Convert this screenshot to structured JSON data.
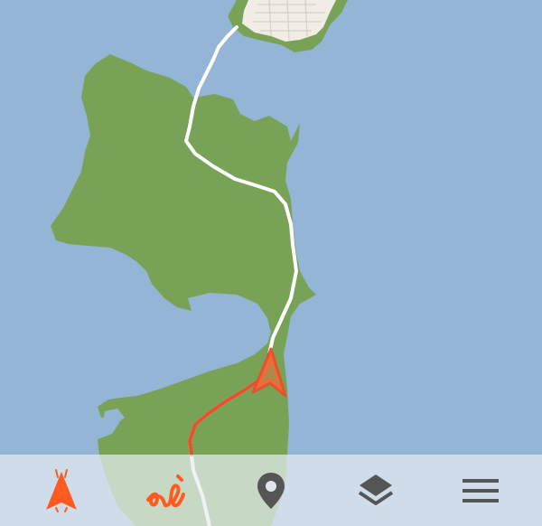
{
  "map": {
    "water_color": "#94b5d6",
    "land_color": "#78a357",
    "town_color": "#f2ece6",
    "route_color": "#ffffff",
    "track_color": "#e8502a"
  },
  "toolbar": {
    "background": "#e8eef4",
    "accent_color": "#ff5a1f",
    "neutral_color": "#555555",
    "buttons": [
      {
        "icon": "navigation-arrow-icon",
        "active": true
      },
      {
        "icon": "route-squiggle-icon",
        "active": true
      },
      {
        "icon": "map-pin-icon",
        "active": false
      },
      {
        "icon": "layers-icon",
        "active": false
      },
      {
        "icon": "menu-icon",
        "active": false
      }
    ]
  }
}
